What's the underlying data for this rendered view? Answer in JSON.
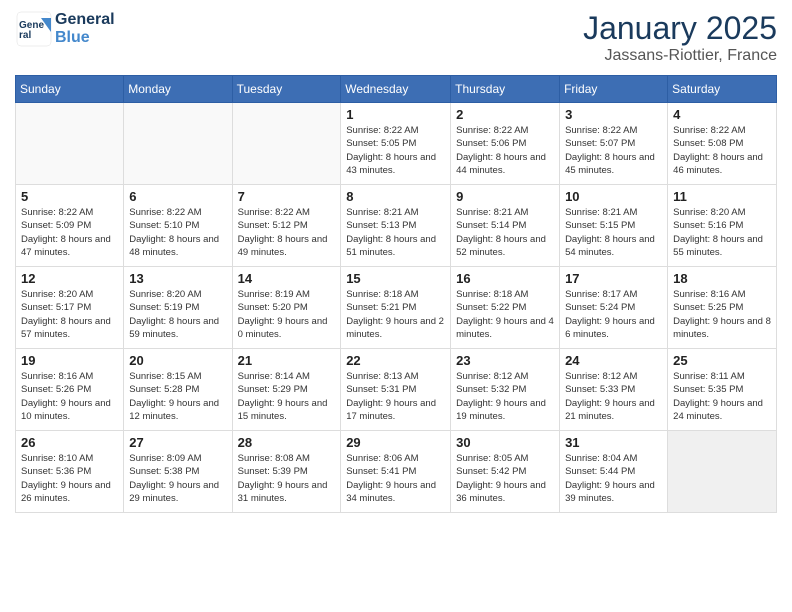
{
  "header": {
    "logo_general": "General",
    "logo_blue": "Blue",
    "month_title": "January 2025",
    "location": "Jassans-Riottier, France"
  },
  "weekdays": [
    "Sunday",
    "Monday",
    "Tuesday",
    "Wednesday",
    "Thursday",
    "Friday",
    "Saturday"
  ],
  "weeks": [
    [
      {
        "day": "",
        "empty": true
      },
      {
        "day": "",
        "empty": true
      },
      {
        "day": "",
        "empty": true
      },
      {
        "day": "1",
        "sunrise": "8:22 AM",
        "sunset": "5:05 PM",
        "daylight": "8 hours and 43 minutes."
      },
      {
        "day": "2",
        "sunrise": "8:22 AM",
        "sunset": "5:06 PM",
        "daylight": "8 hours and 44 minutes."
      },
      {
        "day": "3",
        "sunrise": "8:22 AM",
        "sunset": "5:07 PM",
        "daylight": "8 hours and 45 minutes."
      },
      {
        "day": "4",
        "sunrise": "8:22 AM",
        "sunset": "5:08 PM",
        "daylight": "8 hours and 46 minutes."
      }
    ],
    [
      {
        "day": "5",
        "sunrise": "8:22 AM",
        "sunset": "5:09 PM",
        "daylight": "8 hours and 47 minutes."
      },
      {
        "day": "6",
        "sunrise": "8:22 AM",
        "sunset": "5:10 PM",
        "daylight": "8 hours and 48 minutes."
      },
      {
        "day": "7",
        "sunrise": "8:22 AM",
        "sunset": "5:12 PM",
        "daylight": "8 hours and 49 minutes."
      },
      {
        "day": "8",
        "sunrise": "8:21 AM",
        "sunset": "5:13 PM",
        "daylight": "8 hours and 51 minutes."
      },
      {
        "day": "9",
        "sunrise": "8:21 AM",
        "sunset": "5:14 PM",
        "daylight": "8 hours and 52 minutes."
      },
      {
        "day": "10",
        "sunrise": "8:21 AM",
        "sunset": "5:15 PM",
        "daylight": "8 hours and 54 minutes."
      },
      {
        "day": "11",
        "sunrise": "8:20 AM",
        "sunset": "5:16 PM",
        "daylight": "8 hours and 55 minutes."
      }
    ],
    [
      {
        "day": "12",
        "sunrise": "8:20 AM",
        "sunset": "5:17 PM",
        "daylight": "8 hours and 57 minutes."
      },
      {
        "day": "13",
        "sunrise": "8:20 AM",
        "sunset": "5:19 PM",
        "daylight": "8 hours and 59 minutes."
      },
      {
        "day": "14",
        "sunrise": "8:19 AM",
        "sunset": "5:20 PM",
        "daylight": "9 hours and 0 minutes."
      },
      {
        "day": "15",
        "sunrise": "8:18 AM",
        "sunset": "5:21 PM",
        "daylight": "9 hours and 2 minutes."
      },
      {
        "day": "16",
        "sunrise": "8:18 AM",
        "sunset": "5:22 PM",
        "daylight": "9 hours and 4 minutes."
      },
      {
        "day": "17",
        "sunrise": "8:17 AM",
        "sunset": "5:24 PM",
        "daylight": "9 hours and 6 minutes."
      },
      {
        "day": "18",
        "sunrise": "8:16 AM",
        "sunset": "5:25 PM",
        "daylight": "9 hours and 8 minutes."
      }
    ],
    [
      {
        "day": "19",
        "sunrise": "8:16 AM",
        "sunset": "5:26 PM",
        "daylight": "9 hours and 10 minutes."
      },
      {
        "day": "20",
        "sunrise": "8:15 AM",
        "sunset": "5:28 PM",
        "daylight": "9 hours and 12 minutes."
      },
      {
        "day": "21",
        "sunrise": "8:14 AM",
        "sunset": "5:29 PM",
        "daylight": "9 hours and 15 minutes."
      },
      {
        "day": "22",
        "sunrise": "8:13 AM",
        "sunset": "5:31 PM",
        "daylight": "9 hours and 17 minutes."
      },
      {
        "day": "23",
        "sunrise": "8:12 AM",
        "sunset": "5:32 PM",
        "daylight": "9 hours and 19 minutes."
      },
      {
        "day": "24",
        "sunrise": "8:12 AM",
        "sunset": "5:33 PM",
        "daylight": "9 hours and 21 minutes."
      },
      {
        "day": "25",
        "sunrise": "8:11 AM",
        "sunset": "5:35 PM",
        "daylight": "9 hours and 24 minutes."
      }
    ],
    [
      {
        "day": "26",
        "sunrise": "8:10 AM",
        "sunset": "5:36 PM",
        "daylight": "9 hours and 26 minutes."
      },
      {
        "day": "27",
        "sunrise": "8:09 AM",
        "sunset": "5:38 PM",
        "daylight": "9 hours and 29 minutes."
      },
      {
        "day": "28",
        "sunrise": "8:08 AM",
        "sunset": "5:39 PM",
        "daylight": "9 hours and 31 minutes."
      },
      {
        "day": "29",
        "sunrise": "8:06 AM",
        "sunset": "5:41 PM",
        "daylight": "9 hours and 34 minutes."
      },
      {
        "day": "30",
        "sunrise": "8:05 AM",
        "sunset": "5:42 PM",
        "daylight": "9 hours and 36 minutes."
      },
      {
        "day": "31",
        "sunrise": "8:04 AM",
        "sunset": "5:44 PM",
        "daylight": "9 hours and 39 minutes."
      },
      {
        "day": "",
        "empty": true
      }
    ]
  ]
}
